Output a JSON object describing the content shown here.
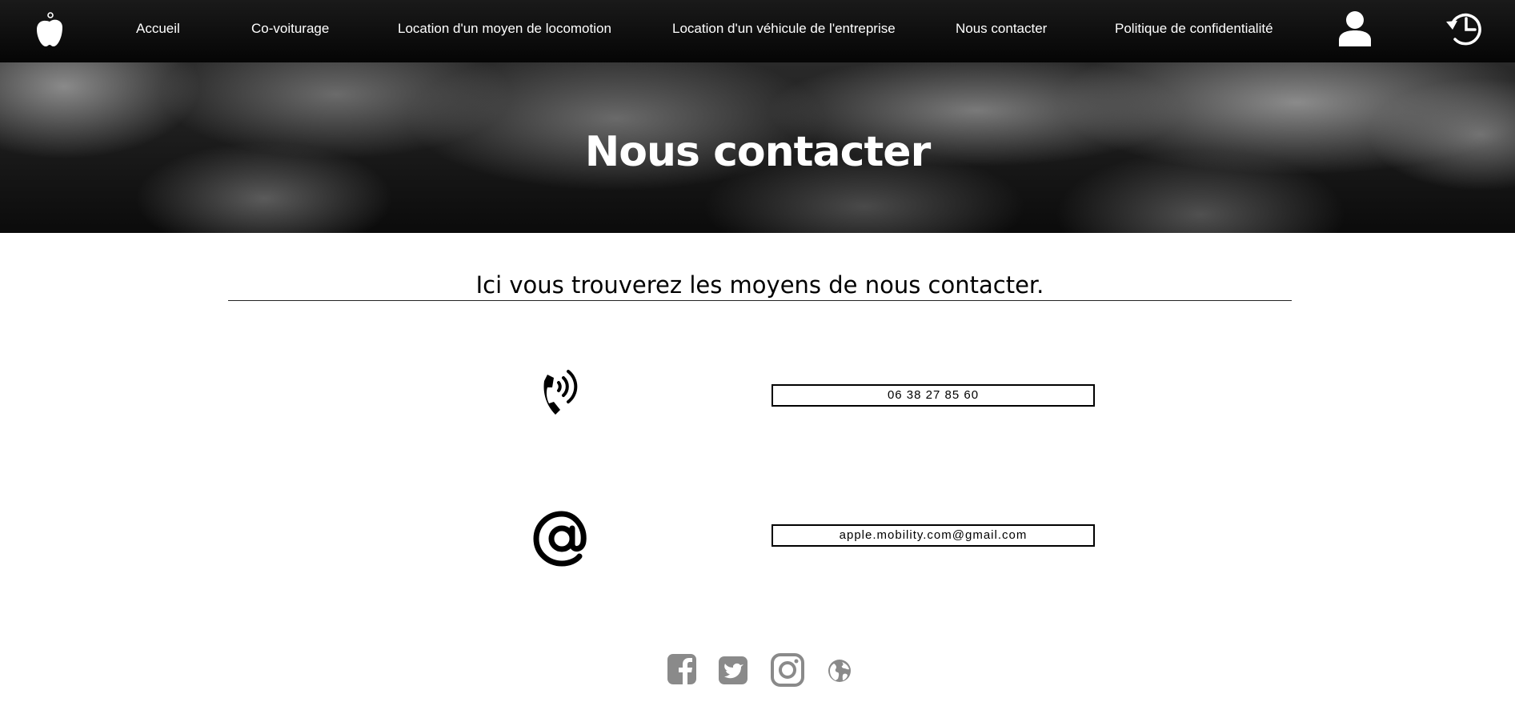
{
  "nav": {
    "logo_icon": "apple-logo-icon",
    "links": [
      {
        "label": "Accueil"
      },
      {
        "label": "Co-voiturage"
      },
      {
        "label": "Location d'un moyen de locomotion"
      },
      {
        "label": "Location d'un véhicule de l'entreprise"
      },
      {
        "label": "Nous contacter"
      },
      {
        "label": "Politique de confidentialité"
      }
    ],
    "user_icon": "user-icon",
    "history_icon": "history-icon"
  },
  "hero": {
    "title": "Nous contacter"
  },
  "main": {
    "intro": "Ici vous trouverez les moyens de nous contacter.",
    "phone": {
      "icon": "phone-icon",
      "value": "06 38 27 85 60"
    },
    "email": {
      "icon": "at-sign-icon",
      "value": "apple.mobility.com@gmail.com"
    }
  },
  "footer": {
    "social_icons": [
      "facebook-icon",
      "twitter-icon",
      "instagram-icon",
      "globe-icon"
    ],
    "icon_color": "#8a8a8a"
  },
  "colors": {
    "nav_bg": "#0d0d0d",
    "text": "#000000",
    "nav_text": "#ffffff"
  }
}
